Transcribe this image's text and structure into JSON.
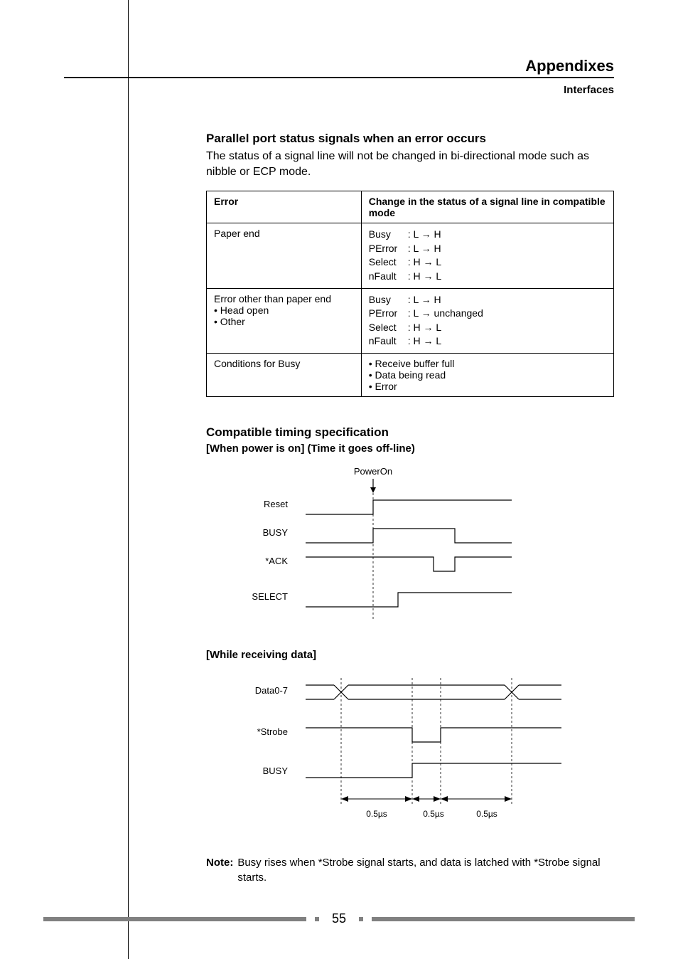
{
  "header": {
    "section": "Appendixes",
    "subsection": "Interfaces"
  },
  "section1": {
    "title": "Parallel port status signals when an error occurs",
    "body": "The status of a signal line will not be changed in bi-directional mode such as nibble or ECP mode."
  },
  "table": {
    "headers": {
      "c1": "Error",
      "c2": "Change in the status of a signal line in compatible mode"
    },
    "row1": {
      "err": "Paper end",
      "l1a": "Busy",
      "l1b": ": L → H",
      "l2a": "PError",
      "l2b": ": L → H",
      "l3a": "Select",
      "l3b": ": H → L",
      "l4a": "nFault",
      "l4b": ": H → L"
    },
    "row2": {
      "err_l1": "Error other than paper end",
      "err_l2": "• Head open",
      "err_l3": "• Other",
      "l1a": "Busy",
      "l1b": ": L → H",
      "l2a": "PError",
      "l2b": ": L → unchanged",
      "l3a": "Select",
      "l3b": ": H → L",
      "l4a": "nFault",
      "l4b": ": H → L"
    },
    "row3": {
      "err": "Conditions for Busy",
      "l1": "• Receive buffer full",
      "l2": "• Data being read",
      "l3": "• Error"
    }
  },
  "section2": {
    "title": "Compatible timing specification",
    "sub1": "[When power is on] (Time it goes off-line)",
    "sub2": "[While receiving data]"
  },
  "diagram1": {
    "poweron": "PowerOn",
    "reset": "Reset",
    "busy": "BUSY",
    "ack": "*ACK",
    "select": "SELECT"
  },
  "diagram2": {
    "data": "Data0-7",
    "strobe": "*Strobe",
    "busy": "BUSY",
    "t1": "0.5µs",
    "t2": "0.5µs",
    "t3": "0.5µs"
  },
  "note": {
    "label": "Note:",
    "text": "Busy rises when *Strobe signal starts, and data is latched with *Strobe signal starts."
  },
  "page_number": "55"
}
